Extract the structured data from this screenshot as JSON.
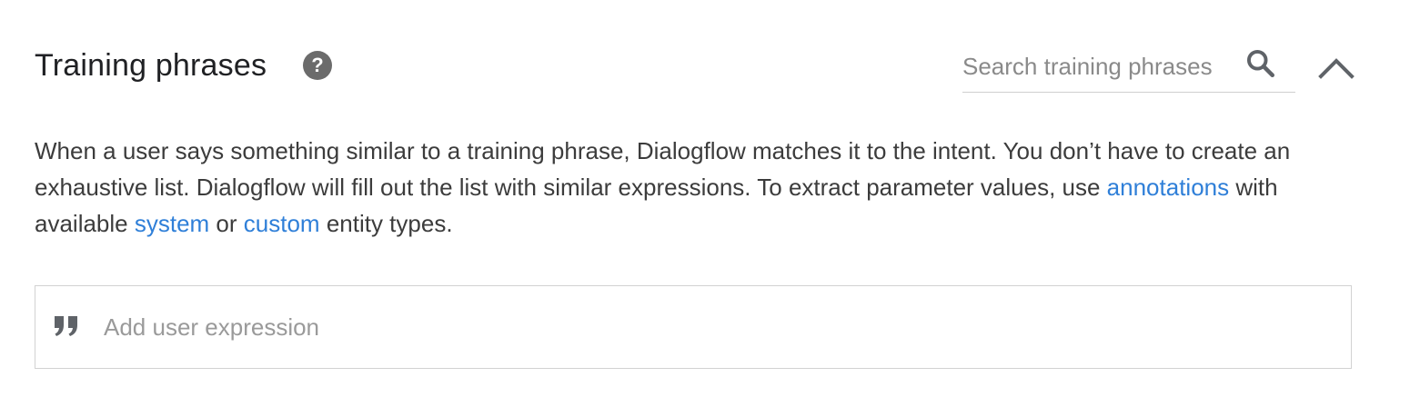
{
  "section": {
    "title": "Training phrases",
    "help_icon_glyph": "?",
    "search": {
      "placeholder": "Search training phrases",
      "value": "",
      "icon": "search-icon"
    },
    "collapse_icon": "chevron-up-icon"
  },
  "description": {
    "part1": "When a user says something similar to a training phrase, Dialogflow matches it to the intent. You don’t have to create an exhaustive list. Dialogflow will fill out the list with similar expressions. To extract parameter values, use ",
    "link_annotations": "annotations",
    "part2": " with available ",
    "link_system": "system",
    "part3": " or ",
    "link_custom": "custom",
    "part4": " entity types."
  },
  "expression_input": {
    "placeholder": "Add user expression",
    "value": "",
    "icon": "quote-icon"
  },
  "colors": {
    "link": "#2f7fd8",
    "title": "#202124",
    "icon": "#6b6b6b",
    "border": "#d2d2d2"
  }
}
